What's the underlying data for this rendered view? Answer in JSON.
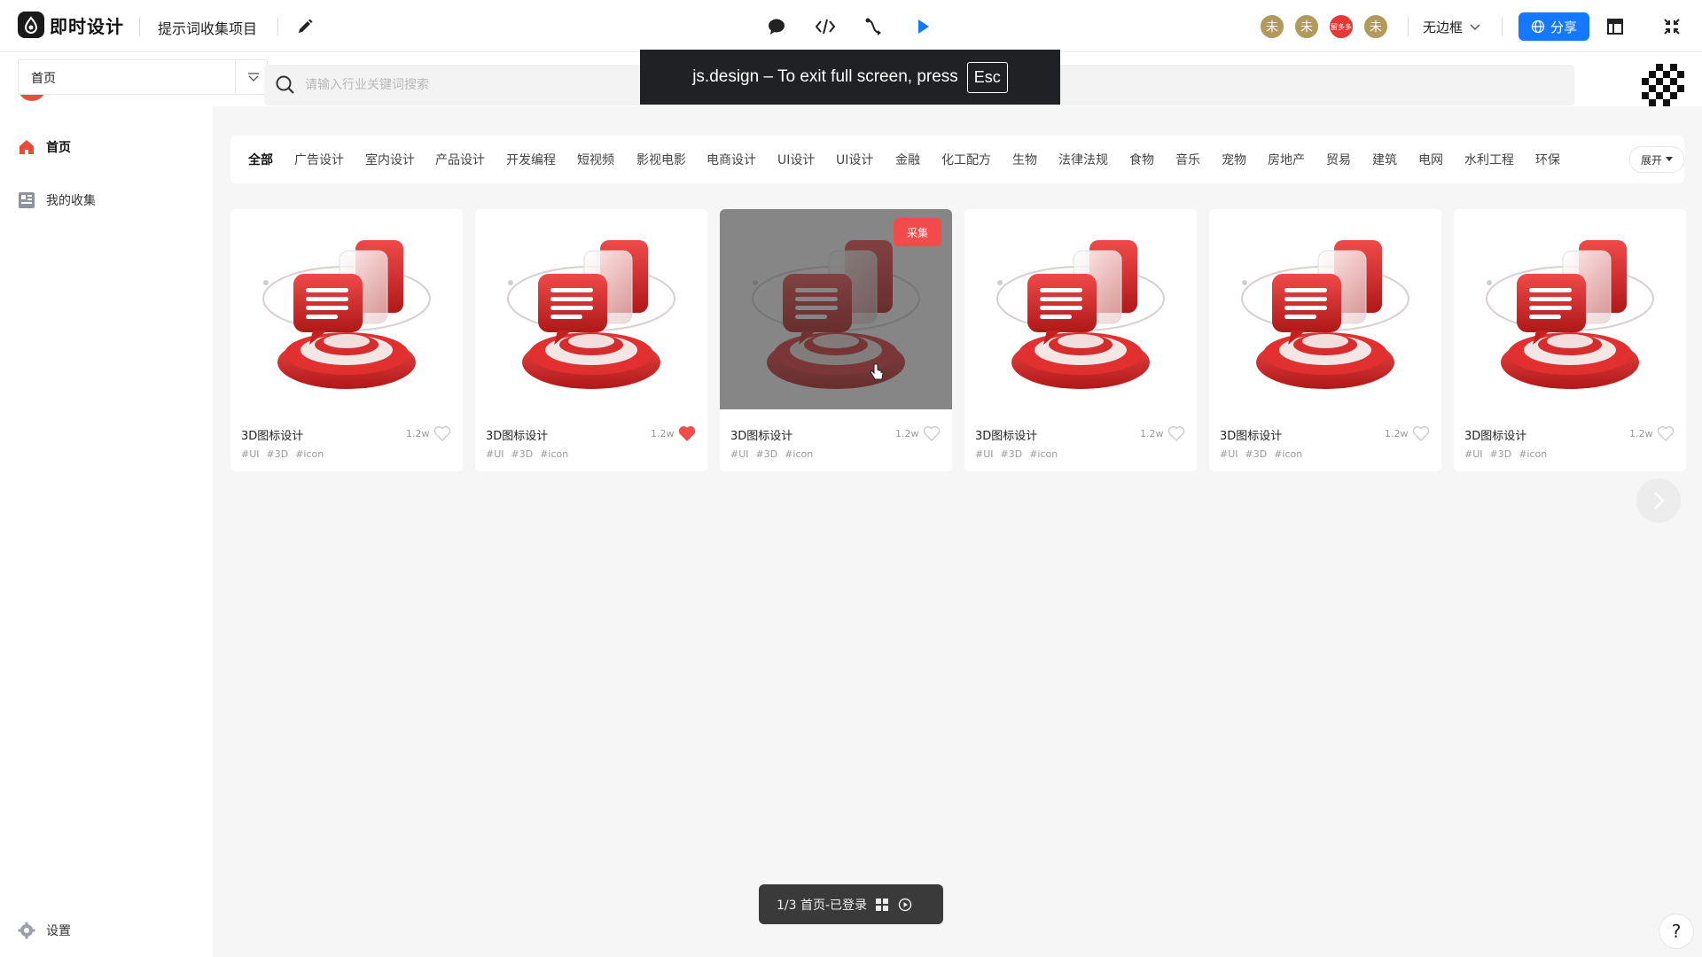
{
  "topbar": {
    "brand": "即时设计",
    "project_name": "提示词收集项目",
    "avatars": [
      "未",
      "未",
      "留多多",
      "未"
    ],
    "frame_mode": "无边框",
    "share_label": "分享"
  },
  "fullscreen_toast": {
    "message": "js.design – To exit full screen, press",
    "key": "Esc"
  },
  "page_select": {
    "current": "首页"
  },
  "search": {
    "placeholder": "请输入行业关键词搜索",
    "value": ""
  },
  "sidebar": {
    "items": [
      {
        "label": "首页",
        "icon": "home-icon",
        "active": true
      },
      {
        "label": "我的收集",
        "icon": "collection-icon",
        "active": false
      }
    ],
    "settings_label": "设置"
  },
  "categories": {
    "items": [
      "全部",
      "广告设计",
      "室内设计",
      "产品设计",
      "开发编程",
      "短视频",
      "影视电影",
      "电商设计",
      "UI设计",
      "UI设计",
      "金融",
      "化工配方",
      "生物",
      "法律法规",
      "食物",
      "音乐",
      "宠物",
      "房地产",
      "贸易",
      "建筑",
      "电网",
      "水利工程",
      "环保"
    ],
    "active_index": 0,
    "expand_label": "展开"
  },
  "cards": [
    {
      "title": "3D图标设计",
      "count": "1.2w",
      "liked": false,
      "tags": [
        "#UI",
        "#3D",
        "#icon"
      ]
    },
    {
      "title": "3D图标设计",
      "count": "1.2w",
      "liked": true,
      "tags": [
        "#UI",
        "#3D",
        "#icon"
      ]
    },
    {
      "title": "3D图标设计",
      "count": "1.2w",
      "liked": false,
      "tags": [
        "#UI",
        "#3D",
        "#icon"
      ],
      "hovered": true,
      "badge": "采集"
    },
    {
      "title": "3D图标设计",
      "count": "1.2w",
      "liked": false,
      "tags": [
        "#UI",
        "#3D",
        "#icon"
      ]
    },
    {
      "title": "3D图标设计",
      "count": "1.2w",
      "liked": false,
      "tags": [
        "#UI",
        "#3D",
        "#icon"
      ]
    },
    {
      "title": "3D图标设计",
      "count": "1.2w",
      "liked": false,
      "tags": [
        "#UI",
        "#3D",
        "#icon"
      ]
    }
  ],
  "page_indicator": {
    "label": "1/3 首页-已登录"
  },
  "help_label": "?",
  "colors": {
    "accent": "#1677ff",
    "brand_red": "#e53935",
    "collect_badge": "#f24b4b"
  }
}
